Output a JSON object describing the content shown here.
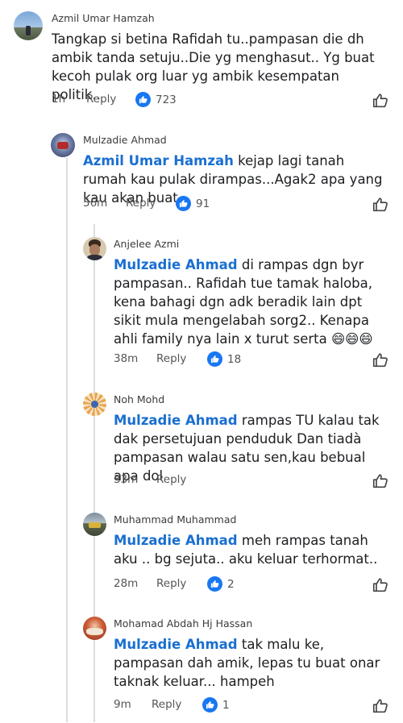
{
  "comments": [
    {
      "author": "Azmil Umar Hamzah",
      "mention": "",
      "text": "Tangkap si betina Rafidah tu..pampasan die dh ambik tanda setuju..Die yg menghasut.. Yg buat kecoh pulak org luar yg ambik kesempatan politik..",
      "time": "1h",
      "reply_label": "Reply",
      "likes": "723"
    },
    {
      "author": "Mulzadie Ahmad",
      "mention": "Azmil Umar Hamzah",
      "text": " kejap lagi tanah rumah kau pulak dirampas...Agak2 apa yang kau akan buat",
      "time": "56m",
      "reply_label": "Reply",
      "likes": "91"
    },
    {
      "author": "Anjelee Azmi",
      "mention": "Mulzadie Ahmad",
      "text": " di rampas dgn byr pampasan.. Rafidah tue tamak haloba, kena bahagi dgn adk beradik lain dpt sikit mula mengelabah sorg2.. Kenapa ahli family nya lain x turut serta 😄😄😄",
      "time": "38m",
      "reply_label": "Reply",
      "likes": "18"
    },
    {
      "author": "Noh Mohd",
      "mention": "Mulzadie Ahmad",
      "text": " rampas TU kalau tak dak persetujuan penduduk Dan tiadà pampasan walau satu sen,kau bebual apa dol",
      "time": "33m",
      "reply_label": "Reply",
      "likes": ""
    },
    {
      "author": "Muhammad Muhammad",
      "mention": "Mulzadie Ahmad",
      "text": " meh rampas tanah aku .. bg sejuta.. aku keluar terhormat..",
      "time": "28m",
      "reply_label": "Reply",
      "likes": "2"
    },
    {
      "author": "Mohamad Abdah Hj Hassan",
      "mention": "Mulzadie Ahmad",
      "text": " tak malu ke, pampasan dah amik, lepas tu buat onar taknak keluar... hampeh",
      "time": "9m",
      "reply_label": "Reply",
      "likes": "1"
    }
  ],
  "colors": {
    "mention": "#1a6fd1",
    "like_badge": "#1877f2",
    "thread_line": "#dadde1"
  },
  "icons": {
    "like_badge": "thumbs-up-filled",
    "like_button": "thumbs-up-outline"
  }
}
